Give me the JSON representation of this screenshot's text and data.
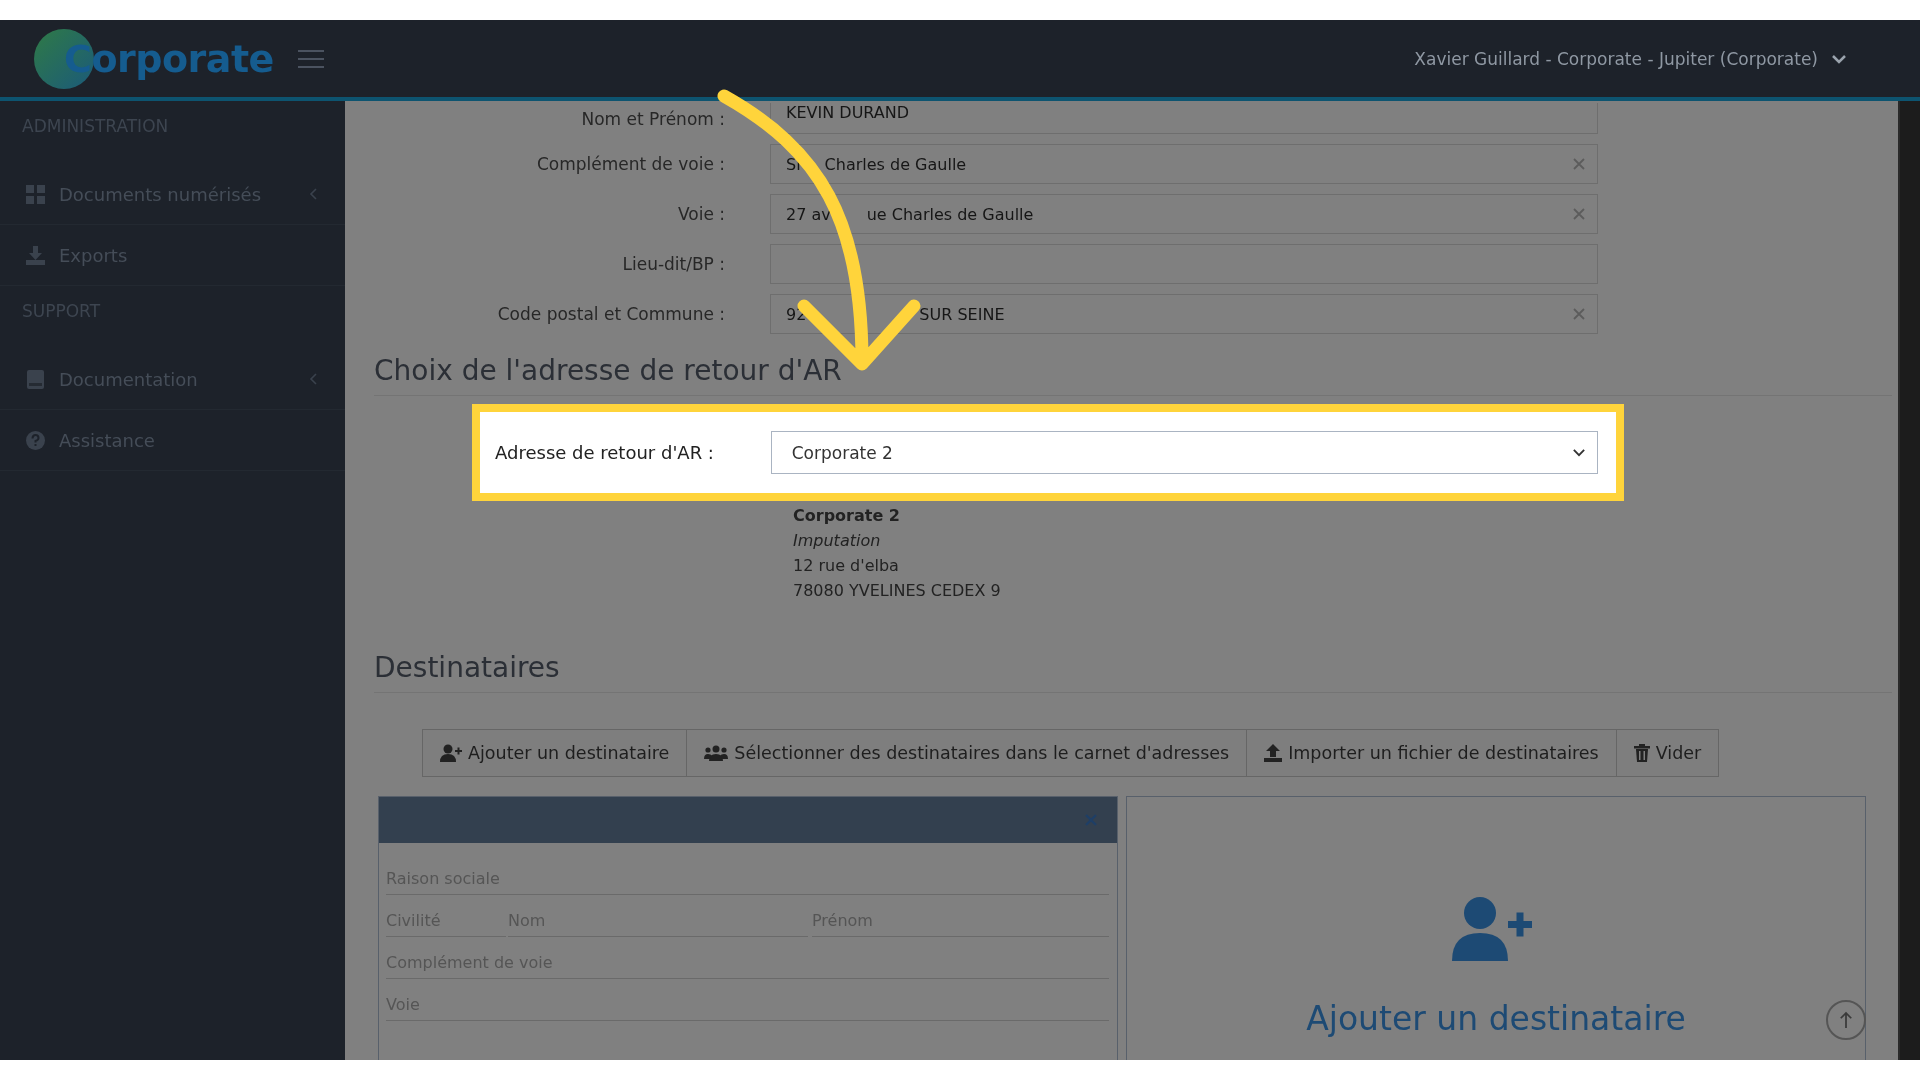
{
  "header": {
    "logo": "Corporate",
    "user": "Xavier Guillard - Corporate - Jupiter (Corporate)"
  },
  "sidebar": {
    "sections": [
      {
        "heading": "ADMINISTRATION",
        "items": [
          {
            "label": "Documents numérisés",
            "expandable": true
          },
          {
            "label": "Exports",
            "expandable": false
          }
        ]
      },
      {
        "heading": "SUPPORT",
        "items": [
          {
            "label": "Documentation",
            "expandable": true
          },
          {
            "label": "Assistance",
            "expandable": false
          }
        ]
      }
    ]
  },
  "form": {
    "fields": [
      {
        "label": "Nom et Prénom :",
        "value": [
          "KEVIN DURAND"
        ],
        "clearable": false
      },
      {
        "label": "Complément de voie :",
        "value": [
          "Si",
          "Charles de Gaulle"
        ],
        "clearable": true
      },
      {
        "label": "Voie :",
        "value": [
          "27 av",
          "ue Charles de Gaulle"
        ],
        "clearable": true
      },
      {
        "label": "Lieu-dit/BP :",
        "clearable": false
      },
      {
        "label": "Code postal et Commune :",
        "value": [
          "92",
          "SUR SEINE"
        ],
        "clearable": true
      }
    ]
  },
  "return_address": {
    "heading": "Choix de l'adresse de retour d'AR",
    "label": "Adresse de retour d'AR :",
    "value": "Corporate 2",
    "details": [
      {
        "kind": "name",
        "text": "Corporate 2"
      },
      {
        "kind": "note",
        "text": "Imputation"
      },
      {
        "kind": "line",
        "text": "12 rue d'elba"
      },
      {
        "kind": "line",
        "text": "78080 YVELINES CEDEX 9"
      }
    ]
  },
  "recipients": {
    "heading": "Destinataires",
    "buttons": [
      {
        "kind": "add",
        "label": "Ajouter un destinataire"
      },
      {
        "kind": "book",
        "label": "Sélectionner des destinataires dans le carnet d'adresses"
      },
      {
        "kind": "import",
        "label": "Importer un fichier de destinataires"
      },
      {
        "kind": "clear",
        "label": "Vider"
      }
    ],
    "form_rows": [
      [
        {
          "placeholder": "Raison sociale"
        }
      ],
      [
        {
          "placeholder": "Civilité"
        },
        {
          "placeholder": "Nom"
        },
        {
          "placeholder": "Prénom"
        }
      ],
      [
        {
          "placeholder": "Complément de voie"
        }
      ],
      [
        {
          "placeholder": "Voie"
        }
      ]
    ],
    "add_panel": {
      "label": "Ajouter un destinataire"
    }
  }
}
